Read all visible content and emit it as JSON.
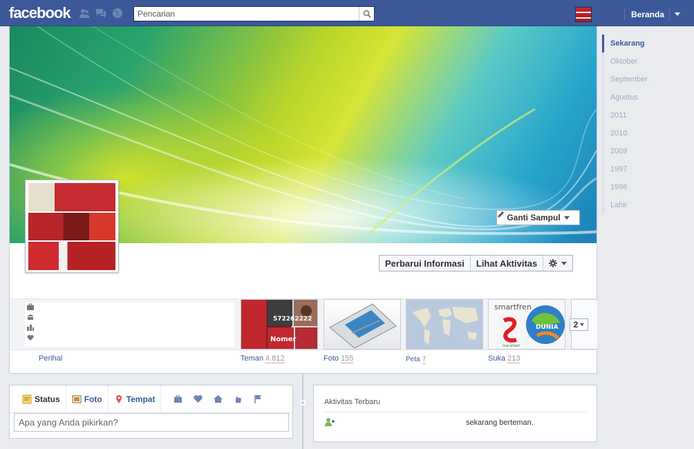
{
  "header": {
    "logo": "facebook",
    "search_placeholder": "Pencarian",
    "home_label": "Beranda"
  },
  "cover": {
    "change_cover_label": "Ganti Sampul"
  },
  "profile": {
    "update_info_label": "Perbarui Informasi",
    "view_activity_label": "Lihat Aktivitas",
    "more_count": "2"
  },
  "tabs": [
    {
      "label": "Perihal",
      "count": ""
    },
    {
      "label": "Teman",
      "count": "4.812"
    },
    {
      "label": "Foto",
      "count": "155"
    },
    {
      "label": "Peta",
      "count": "7"
    },
    {
      "label": "Suka",
      "count": "213"
    }
  ],
  "tile_texts": {
    "friends_number": "572262222",
    "friends_word": "Nomer",
    "likes_brand": "smartfren",
    "likes_tagline": "live smart",
    "likes_globe": "DUNIA"
  },
  "scrubber": [
    {
      "label": "Sekarang",
      "active": true
    },
    {
      "label": "Oktober",
      "active": false
    },
    {
      "label": "September",
      "active": false
    },
    {
      "label": "Agustus",
      "active": false
    },
    {
      "label": "2011",
      "active": false
    },
    {
      "label": "2010",
      "active": false
    },
    {
      "label": "2009",
      "active": false
    },
    {
      "label": "1997",
      "active": false
    },
    {
      "label": "1996",
      "active": false
    },
    {
      "label": "Lahir",
      "active": false
    }
  ],
  "composer": {
    "status_label": "Status",
    "photo_label": "Foto",
    "place_label": "Tempat",
    "input_placeholder": "Apa yang Anda pikirkan?"
  },
  "activity": {
    "title": "Aktivitas Terbaru",
    "item_text": "sekarang berteman."
  },
  "colors": {
    "brand": "#3b5998",
    "page_bg": "#e9ebee"
  }
}
